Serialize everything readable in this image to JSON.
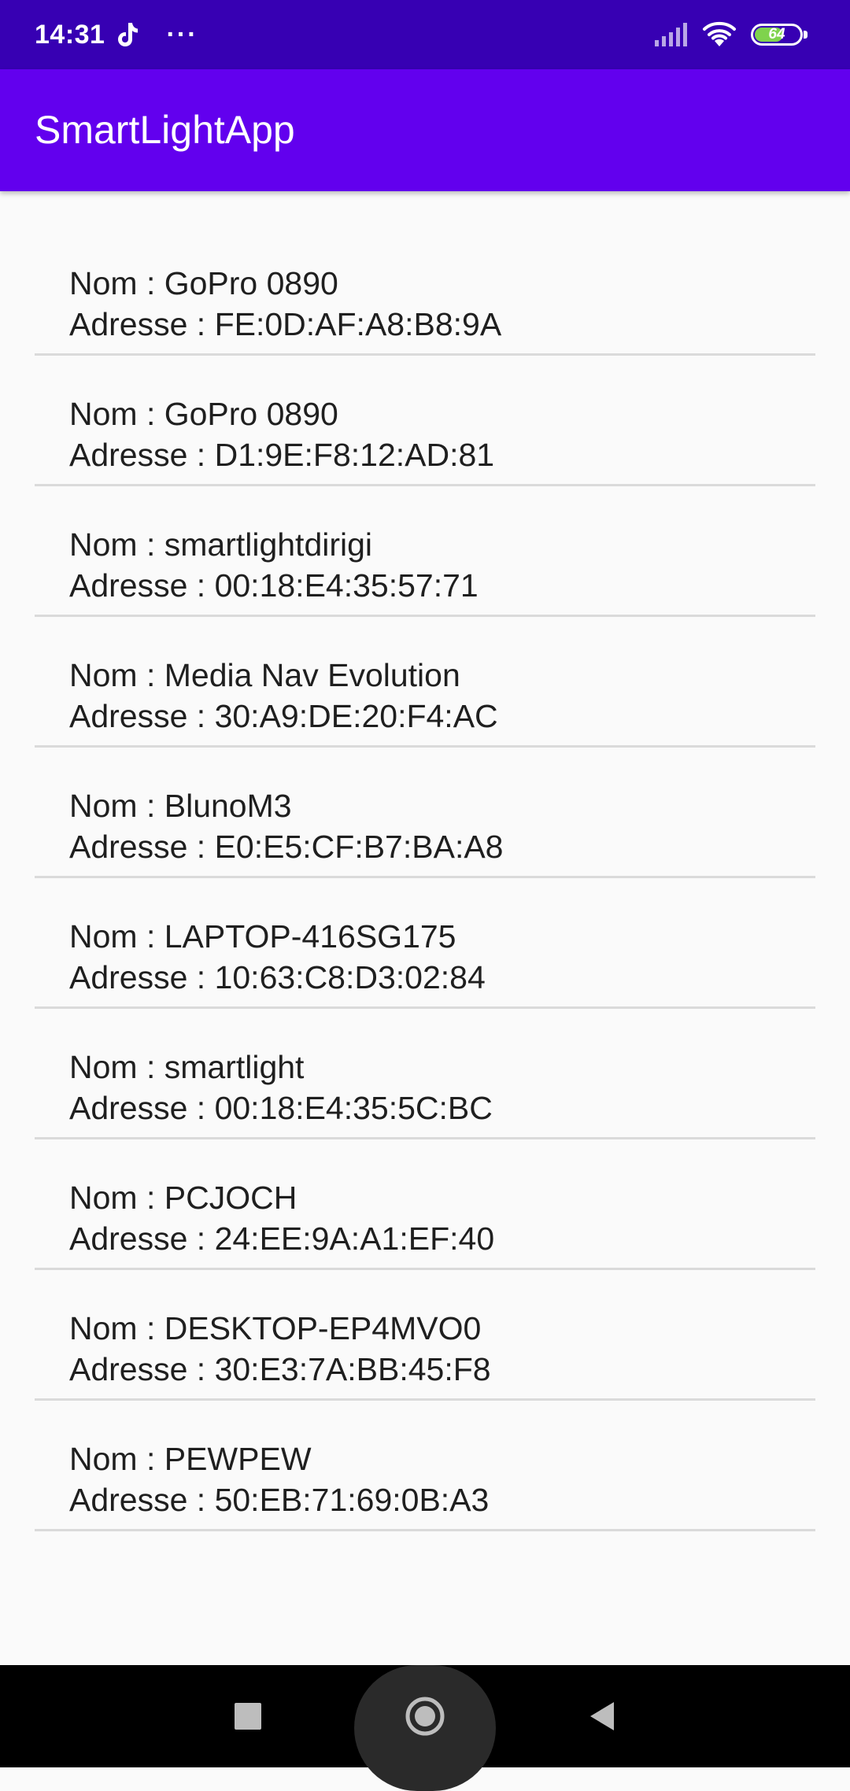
{
  "status_bar": {
    "time": "14:31",
    "more_indicator": "···",
    "battery_level": "64",
    "icons": [
      "tiktok-notification-icon",
      "cellular-signal-icon",
      "wifi-icon",
      "battery-icon"
    ]
  },
  "app_bar": {
    "title": "SmartLightApp"
  },
  "devices": [
    {
      "name": "Nom : GoPro 0890",
      "address": "Adresse : FE:0D:AF:A8:B8:9A"
    },
    {
      "name": "Nom : GoPro 0890",
      "address": "Adresse : D1:9E:F8:12:AD:81"
    },
    {
      "name": "Nom : smartlightdirigi",
      "address": "Adresse : 00:18:E4:35:57:71"
    },
    {
      "name": "Nom : Media Nav Evolution",
      "address": "Adresse : 30:A9:DE:20:F4:AC"
    },
    {
      "name": "Nom : BlunoM3",
      "address": "Adresse : E0:E5:CF:B7:BA:A8"
    },
    {
      "name": "Nom : LAPTOP-416SG175",
      "address": "Adresse : 10:63:C8:D3:02:84"
    },
    {
      "name": "Nom : smartlight",
      "address": "Adresse : 00:18:E4:35:5C:BC"
    },
    {
      "name": "Nom : PCJOCH",
      "address": "Adresse : 24:EE:9A:A1:EF:40"
    },
    {
      "name": "Nom : DESKTOP-EP4MVO0",
      "address": "Adresse : 30:E3:7A:BB:45:F8"
    },
    {
      "name": "Nom : PEWPEW",
      "address": "Adresse : 50:EB:71:69:0B:A3"
    }
  ],
  "nav_bar": {
    "icons": [
      "recents-square-icon",
      "home-circle-icon",
      "back-triangle-icon"
    ]
  },
  "colors": {
    "status_bar": "#3700b3",
    "app_bar": "#6200ee",
    "background": "#fafafa",
    "divider": "#dadada",
    "battery_fill": "#7fd34d"
  }
}
